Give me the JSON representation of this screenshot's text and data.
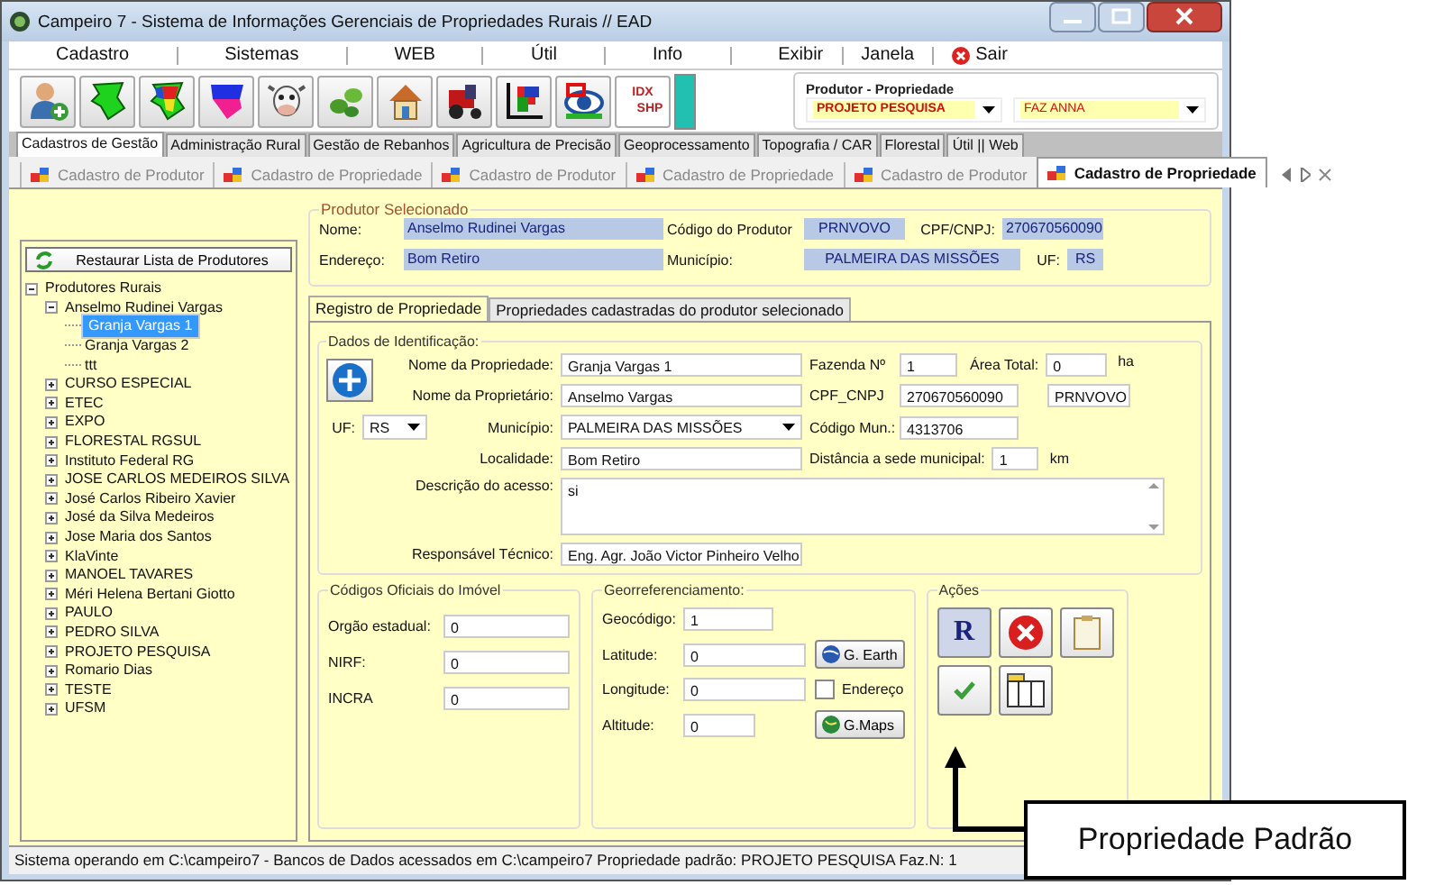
{
  "window": {
    "title": "Campeiro 7 - Sistema de Informações Gerenciais de Propriedades Rurais // EAD"
  },
  "menu": [
    {
      "label": "Cadastro",
      "kind": "menu"
    },
    {
      "label": "Sistemas",
      "kind": "menu"
    },
    {
      "label": "WEB",
      "kind": "menu"
    },
    {
      "label": "Útil",
      "kind": "menu"
    },
    {
      "label": "Info",
      "kind": "menu"
    },
    {
      "label": "Exibir",
      "kind": "menu"
    },
    {
      "label": "Janela",
      "kind": "menu"
    },
    {
      "label": "Sair",
      "kind": "exit"
    }
  ],
  "toolbar": {
    "shp_button": {
      "line1": "IDX",
      "line2": "SHP"
    }
  },
  "selector": {
    "title": "Produtor - Propriedade",
    "producer": "PROJETO PESQUISA",
    "property": "FAZ ANNA"
  },
  "module_tabs": [
    {
      "label": "Cadastros de Gestão",
      "selected": true
    },
    {
      "label": "Administração Rural",
      "selected": false
    },
    {
      "label": "Gestão de Rebanhos",
      "selected": false
    },
    {
      "label": "Agricultura de Precisão",
      "selected": false
    },
    {
      "label": "Geoprocessamento",
      "selected": false
    },
    {
      "label": "Topografia / CAR",
      "selected": false
    },
    {
      "label": "Florestal",
      "selected": false
    },
    {
      "label": "Útil || Web",
      "selected": false
    }
  ],
  "doc_tabs": [
    {
      "label": "Cadastro de Produtor",
      "selected": false
    },
    {
      "label": "Cadastro de Propriedade",
      "selected": false
    },
    {
      "label": "Cadastro de Produtor",
      "selected": false
    },
    {
      "label": "Cadastro de Propriedade",
      "selected": false
    },
    {
      "label": "Cadastro de Produtor",
      "selected": false
    },
    {
      "label": "Cadastro de Propriedade",
      "selected": true
    }
  ],
  "tree": {
    "restore_button": "Restaurar Lista de Produtores",
    "root": {
      "label": "Produtores Rurais",
      "expanded": true,
      "selected": false,
      "children": [
        {
          "label": "Anselmo Rudinei Vargas",
          "expanded": true,
          "selected": false,
          "children": [
            {
              "label": "Granja Vargas 1",
              "selected": true
            },
            {
              "label": "Granja Vargas 2",
              "selected": false
            },
            {
              "label": "ttt",
              "selected": false
            }
          ]
        },
        {
          "label": "CURSO ESPECIAL",
          "expanded": false,
          "selected": false
        },
        {
          "label": "ETEC",
          "expanded": false,
          "selected": false
        },
        {
          "label": "EXPO",
          "expanded": false,
          "selected": false
        },
        {
          "label": "FLORESTAL RGSUL",
          "expanded": false,
          "selected": false
        },
        {
          "label": "Instituto Federal RG",
          "expanded": false,
          "selected": false
        },
        {
          "label": "JOSE CARLOS MEDEIROS SILVA",
          "expanded": false,
          "selected": false
        },
        {
          "label": "José Carlos Ribeiro Xavier",
          "expanded": false,
          "selected": false
        },
        {
          "label": "José da Silva Medeiros",
          "expanded": false,
          "selected": false
        },
        {
          "label": "Jose Maria dos Santos",
          "expanded": false,
          "selected": false
        },
        {
          "label": "KlaVinte",
          "expanded": false,
          "selected": false
        },
        {
          "label": "MANOEL TAVARES",
          "expanded": false,
          "selected": false
        },
        {
          "label": "Méri Helena Bertani Giotto",
          "expanded": false,
          "selected": false
        },
        {
          "label": "PAULO",
          "expanded": false,
          "selected": false
        },
        {
          "label": "PEDRO SILVA",
          "expanded": false,
          "selected": false
        },
        {
          "label": "PROJETO PESQUISA",
          "expanded": false,
          "selected": false
        },
        {
          "label": "Romario Dias",
          "expanded": false,
          "selected": false
        },
        {
          "label": "TESTE",
          "expanded": false,
          "selected": false
        },
        {
          "label": "UFSM",
          "expanded": false,
          "selected": false
        }
      ]
    }
  },
  "produtor": {
    "title": "Produtor Selecionado",
    "nome": {
      "label": "Nome:",
      "value": "Anselmo Rudinei Vargas"
    },
    "codigo": {
      "label": "Código do Produtor",
      "value": "PRNVOVO"
    },
    "cpf": {
      "label": "CPF/CNPJ:",
      "value": "270670560090"
    },
    "endereco": {
      "label": "Endereço:",
      "value": "Bom Retiro"
    },
    "municipio": {
      "label": "Município:",
      "value": "PALMEIRA DAS MISSÕES"
    },
    "uf": {
      "label": "UF:",
      "value": "RS"
    }
  },
  "form_tabs": [
    {
      "label": "Registro de Propriedade",
      "selected": true
    },
    {
      "label": "Propriedades cadastradas do produtor selecionado",
      "selected": false
    }
  ],
  "identificacao": {
    "title": "Dados de Identificação:",
    "nome_propriedade": {
      "label": "Nome da Propriedade:",
      "value": "Granja Vargas 1"
    },
    "fazenda": {
      "label": "Fazenda Nº",
      "value": "1"
    },
    "area": {
      "label": "Área Total:",
      "value": "0",
      "unit": "ha"
    },
    "proprietario": {
      "label": "Nome da Proprietário:",
      "value": "Anselmo Vargas"
    },
    "cpf": {
      "label": "CPF_CNPJ",
      "value": "270670560090"
    },
    "codigo_produtor": {
      "value": "PRNVOVO"
    },
    "uf": {
      "label": "UF:",
      "value": "RS"
    },
    "municipio": {
      "label": "Município:",
      "value": "PALMEIRA DAS MISSÕES"
    },
    "codigo_mun": {
      "label": "Código Mun.:",
      "value": "4313706"
    },
    "localidade": {
      "label": "Localidade:",
      "value": "Bom Retiro"
    },
    "distancia": {
      "label": "Distância a sede municipal:",
      "value": "1",
      "unit": "km"
    },
    "descricao": {
      "label": "Descrição do acesso:",
      "value": "si"
    },
    "responsavel": {
      "label": "Responsável Técnico:",
      "value": "Eng. Agr. João Victor Pinheiro Velho"
    }
  },
  "codigos": {
    "title": "Códigos Oficiais do Imóvel",
    "fields": [
      {
        "label": "Orgão estadual:",
        "value": "0"
      },
      {
        "label": "NIRF:",
        "value": "0"
      },
      {
        "label": "INCRA",
        "value": "0"
      }
    ]
  },
  "georef": {
    "title": "Georreferenciamento:",
    "geocodigo": {
      "label": "Geocódigo:",
      "value": "1"
    },
    "latitude": {
      "label": "Latitude:",
      "value": "0"
    },
    "longitude": {
      "label": "Longitude:",
      "value": "0"
    },
    "altitude": {
      "label": "Altitude:",
      "value": "0"
    },
    "earth_button": "G. Earth",
    "maps_button": "G.Maps",
    "checkbox": {
      "label": "Endereço",
      "checked": false
    }
  },
  "acoes": {
    "title": "Ações",
    "report_letter": "R"
  },
  "status_bar": "Sistema operando em C:\\campeiro7  -  Bancos de Dados acessados em C:\\campeiro7  Propriedade padrão: PROJETO PESQUISA Faz.N: 1",
  "annotation": "Propriedade Padrão"
}
